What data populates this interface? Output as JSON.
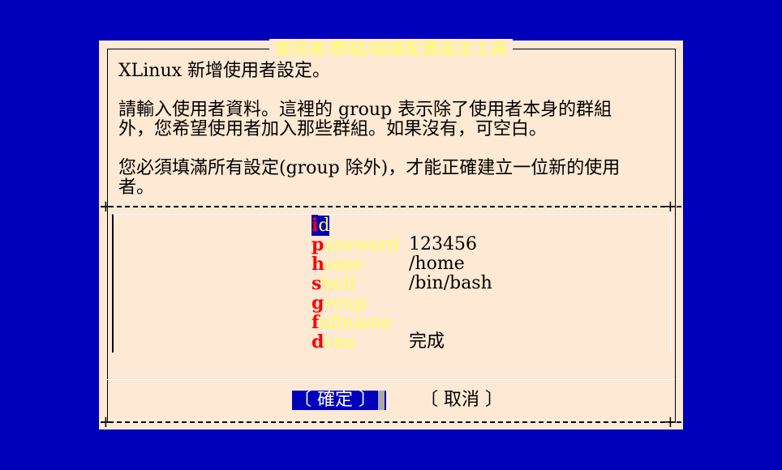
{
  "dialog": {
    "title": "使用者/群組/磁碟配置設定工具",
    "intro_line1": "XLinux 新增使用者設定。",
    "intro_line2": "請輸入使用者資料。這裡的 group 表示除了使用者本身的群組",
    "intro_line3": "外，您希望使用者加入那些群組。如果沒有，可空白。",
    "intro_line4": "您必須填滿所有設定(group 除外)，才能正確建立一位新的使用",
    "intro_line5": "者。"
  },
  "menu": {
    "items": [
      {
        "hotkey": "i",
        "rest": "d",
        "value": ""
      },
      {
        "hotkey": "p",
        "rest": "assword",
        "value": "123456"
      },
      {
        "hotkey": "h",
        "rest": "ome",
        "value": "/home"
      },
      {
        "hotkey": "s",
        "rest": "hell",
        "value": "/bin/bash"
      },
      {
        "hotkey": "g",
        "rest": "roup",
        "value": ""
      },
      {
        "hotkey": "f",
        "rest": "ullname",
        "value": ""
      },
      {
        "hotkey": "d",
        "rest": "one",
        "value": "完成"
      }
    ],
    "selected_index": 0
  },
  "buttons": {
    "ok_label": "〔 確定 〕",
    "cancel_label": "〔 取消 〕"
  },
  "colors": {
    "screen_background": "#0000bb",
    "dialog_background": "#fde9d4",
    "title_color": "#ffff55",
    "hotkey_color": "#ff0000",
    "item_color": "#ffff55"
  }
}
